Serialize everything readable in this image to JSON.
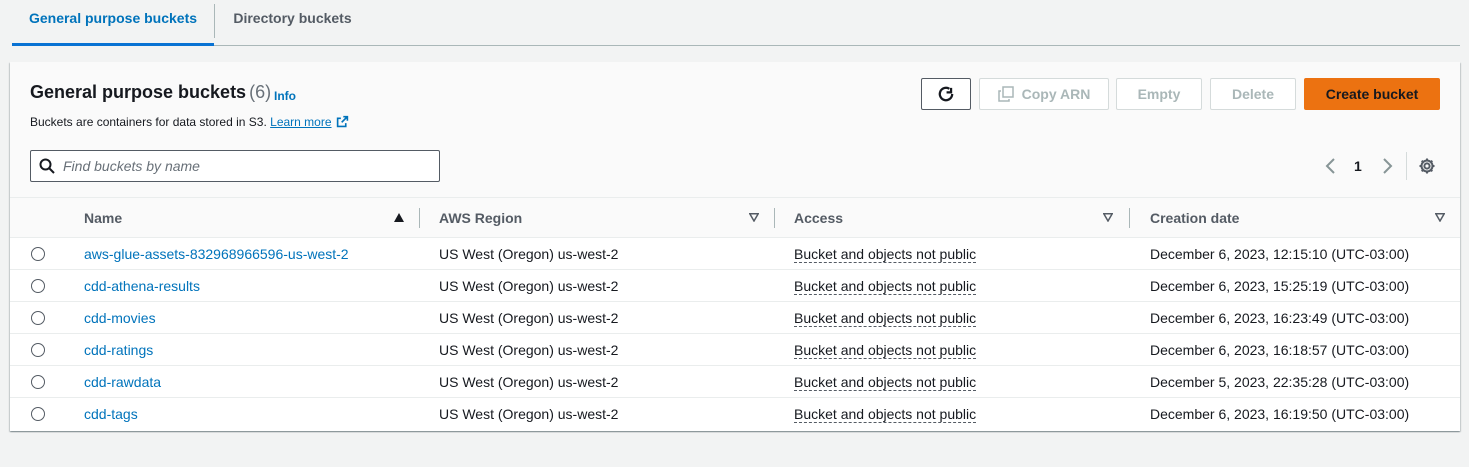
{
  "tabs": [
    {
      "label": "General purpose buckets",
      "active": true
    },
    {
      "label": "Directory buckets",
      "active": false
    }
  ],
  "panel": {
    "title": "General purpose buckets",
    "count": "(6)",
    "info": "Info",
    "description": "Buckets are containers for data stored in S3.",
    "learn_more": "Learn more"
  },
  "actions": {
    "refresh_icon": "refresh-icon",
    "copy_arn": "Copy ARN",
    "empty": "Empty",
    "delete": "Delete",
    "create": "Create bucket"
  },
  "search": {
    "placeholder": "Find buckets by name",
    "value": ""
  },
  "pagination": {
    "page": "1"
  },
  "columns": [
    {
      "label": "Name",
      "sort": "ascending"
    },
    {
      "label": "AWS Region",
      "sort": "none"
    },
    {
      "label": "Access",
      "sort": "none"
    },
    {
      "label": "Creation date",
      "sort": "none"
    }
  ],
  "buckets": [
    {
      "name": "aws-glue-assets-832968966596-us-west-2",
      "region": "US West (Oregon) us-west-2",
      "access": "Bucket and objects not public",
      "created": "December 6, 2023, 12:15:10 (UTC-03:00)"
    },
    {
      "name": "cdd-athena-results",
      "region": "US West (Oregon) us-west-2",
      "access": "Bucket and objects not public",
      "created": "December 6, 2023, 15:25:19 (UTC-03:00)"
    },
    {
      "name": "cdd-movies",
      "region": "US West (Oregon) us-west-2",
      "access": "Bucket and objects not public",
      "created": "December 6, 2023, 16:23:49 (UTC-03:00)"
    },
    {
      "name": "cdd-ratings",
      "region": "US West (Oregon) us-west-2",
      "access": "Bucket and objects not public",
      "created": "December 6, 2023, 16:18:57 (UTC-03:00)"
    },
    {
      "name": "cdd-rawdata",
      "region": "US West (Oregon) us-west-2",
      "access": "Bucket and objects not public",
      "created": "December 5, 2023, 22:35:28 (UTC-03:00)"
    },
    {
      "name": "cdd-tags",
      "region": "US West (Oregon) us-west-2",
      "access": "Bucket and objects not public",
      "created": "December 6, 2023, 16:19:50 (UTC-03:00)"
    }
  ],
  "colors": {
    "link": "#0073bb",
    "primary": "#ec7211",
    "text": "#16191f",
    "muted": "#545b64"
  }
}
